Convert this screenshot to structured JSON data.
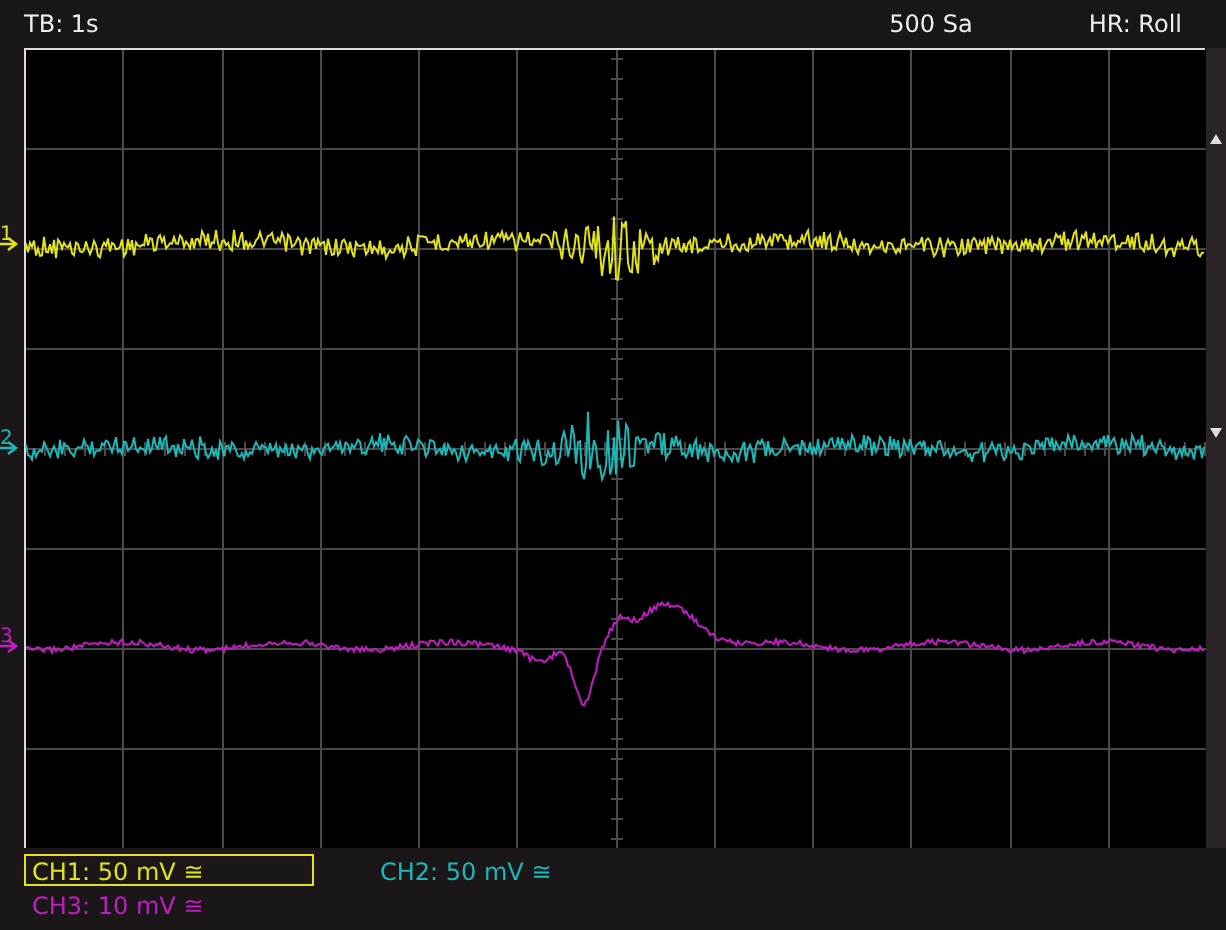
{
  "top_bar": {
    "timebase": "TB: 1s",
    "sample_count": "500 Sa",
    "acquisition_mode": "HR: Roll"
  },
  "channels": [
    {
      "marker": "1",
      "label": "CH1: 50 mV ≅",
      "color": "#e2e21c",
      "selected": true
    },
    {
      "marker": "2",
      "label": "CH2: 50 mV ≅",
      "color": "#1cb8b8",
      "selected": false
    },
    {
      "marker": "3",
      "label": "CH3: 10 mV ≅",
      "color": "#c41cc4",
      "selected": false
    }
  ]
}
